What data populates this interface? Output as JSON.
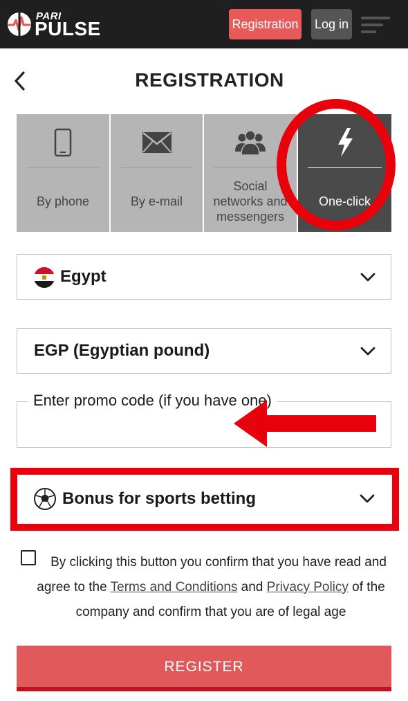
{
  "header": {
    "logo_top": "PARI",
    "logo_main": "PULSE",
    "registration_label": "Registration",
    "login_label": "Log in"
  },
  "page": {
    "title": "REGISTRATION"
  },
  "tabs": [
    {
      "label": "By phone",
      "icon": "phone-icon",
      "active": false
    },
    {
      "label": "By e-mail",
      "icon": "envelope-icon",
      "active": false
    },
    {
      "label": "Social networks and messengers",
      "icon": "users-icon",
      "active": false
    },
    {
      "label": "One-click",
      "icon": "lightning-icon",
      "active": true
    }
  ],
  "form": {
    "country": "Egypt",
    "currency": "EGP (Egyptian pound)",
    "promo_label": "Enter promo code (if you have one)",
    "promo_value": "",
    "bonus": "Bonus for sports betting",
    "agreement": {
      "text_before": "By clicking this button you confirm that you have read and agree to the ",
      "terms_link": "Terms and Conditions",
      "and": " and ",
      "privacy_link": "Privacy Policy",
      "text_after": " of the company and confirm that you are of legal age",
      "checked": false
    },
    "register_label": "REGISTER"
  },
  "colors": {
    "header_bg": "#1f1f1f",
    "accent_red": "#e85a5a",
    "annotation_red": "#e8000b",
    "tab_inactive": "#b5b5b5",
    "tab_active": "#4a4a4a"
  }
}
